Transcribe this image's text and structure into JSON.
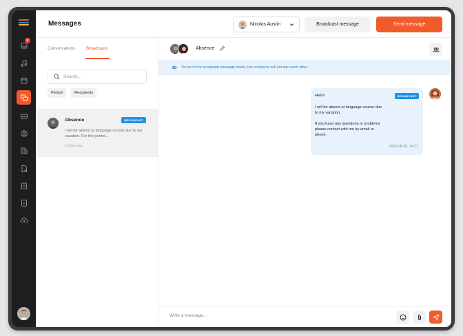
{
  "header": {
    "title": "Messages",
    "user_name": "Nicolas Austin",
    "broadcast_label": "Broadcast message",
    "send_label": "Send message"
  },
  "sidebar": {
    "notification_count": "2",
    "items": [
      {
        "icon": "inbox-icon"
      },
      {
        "icon": "music-note-icon"
      },
      {
        "icon": "calendar-icon"
      },
      {
        "icon": "messages-icon",
        "active": true
      },
      {
        "icon": "bus-icon"
      },
      {
        "icon": "user-circle-icon"
      },
      {
        "icon": "building-icon"
      },
      {
        "icon": "document-icon"
      },
      {
        "icon": "clipboard-icon"
      },
      {
        "icon": "file-icon"
      },
      {
        "icon": "cloud-upload-icon"
      }
    ]
  },
  "tabs": {
    "conversations": "Conversations",
    "broadcasts": "Broadcasts"
  },
  "search": {
    "placeholder": "Search..."
  },
  "filters": {
    "period": "Period",
    "recipients": "Recipients"
  },
  "conversation": {
    "name": "Absence",
    "tag": "BROADCAST",
    "preview": "I will be absent at language course due to my vacation. For the period...",
    "time": "1 hour ago"
  },
  "chat": {
    "title": "Absence",
    "notice": "You're in the broadcast message mode, the recipients will not see each other.",
    "message": {
      "title": "Hello!",
      "tag": "BROADCAST",
      "body": "I will be absent at language course due\nto my vacation.\n\nIf you have any questions or problems\nplease contact with me by email or\nphone.",
      "time": "2022-08-30, 14:27"
    },
    "composer_placeholder": "Write a message..."
  },
  "colors": {
    "accent": "#f15a2b",
    "broadcast_tag": "#1f93e6",
    "notice_bg": "#e8f2fb",
    "sidebar_bg": "#1e1e20"
  }
}
